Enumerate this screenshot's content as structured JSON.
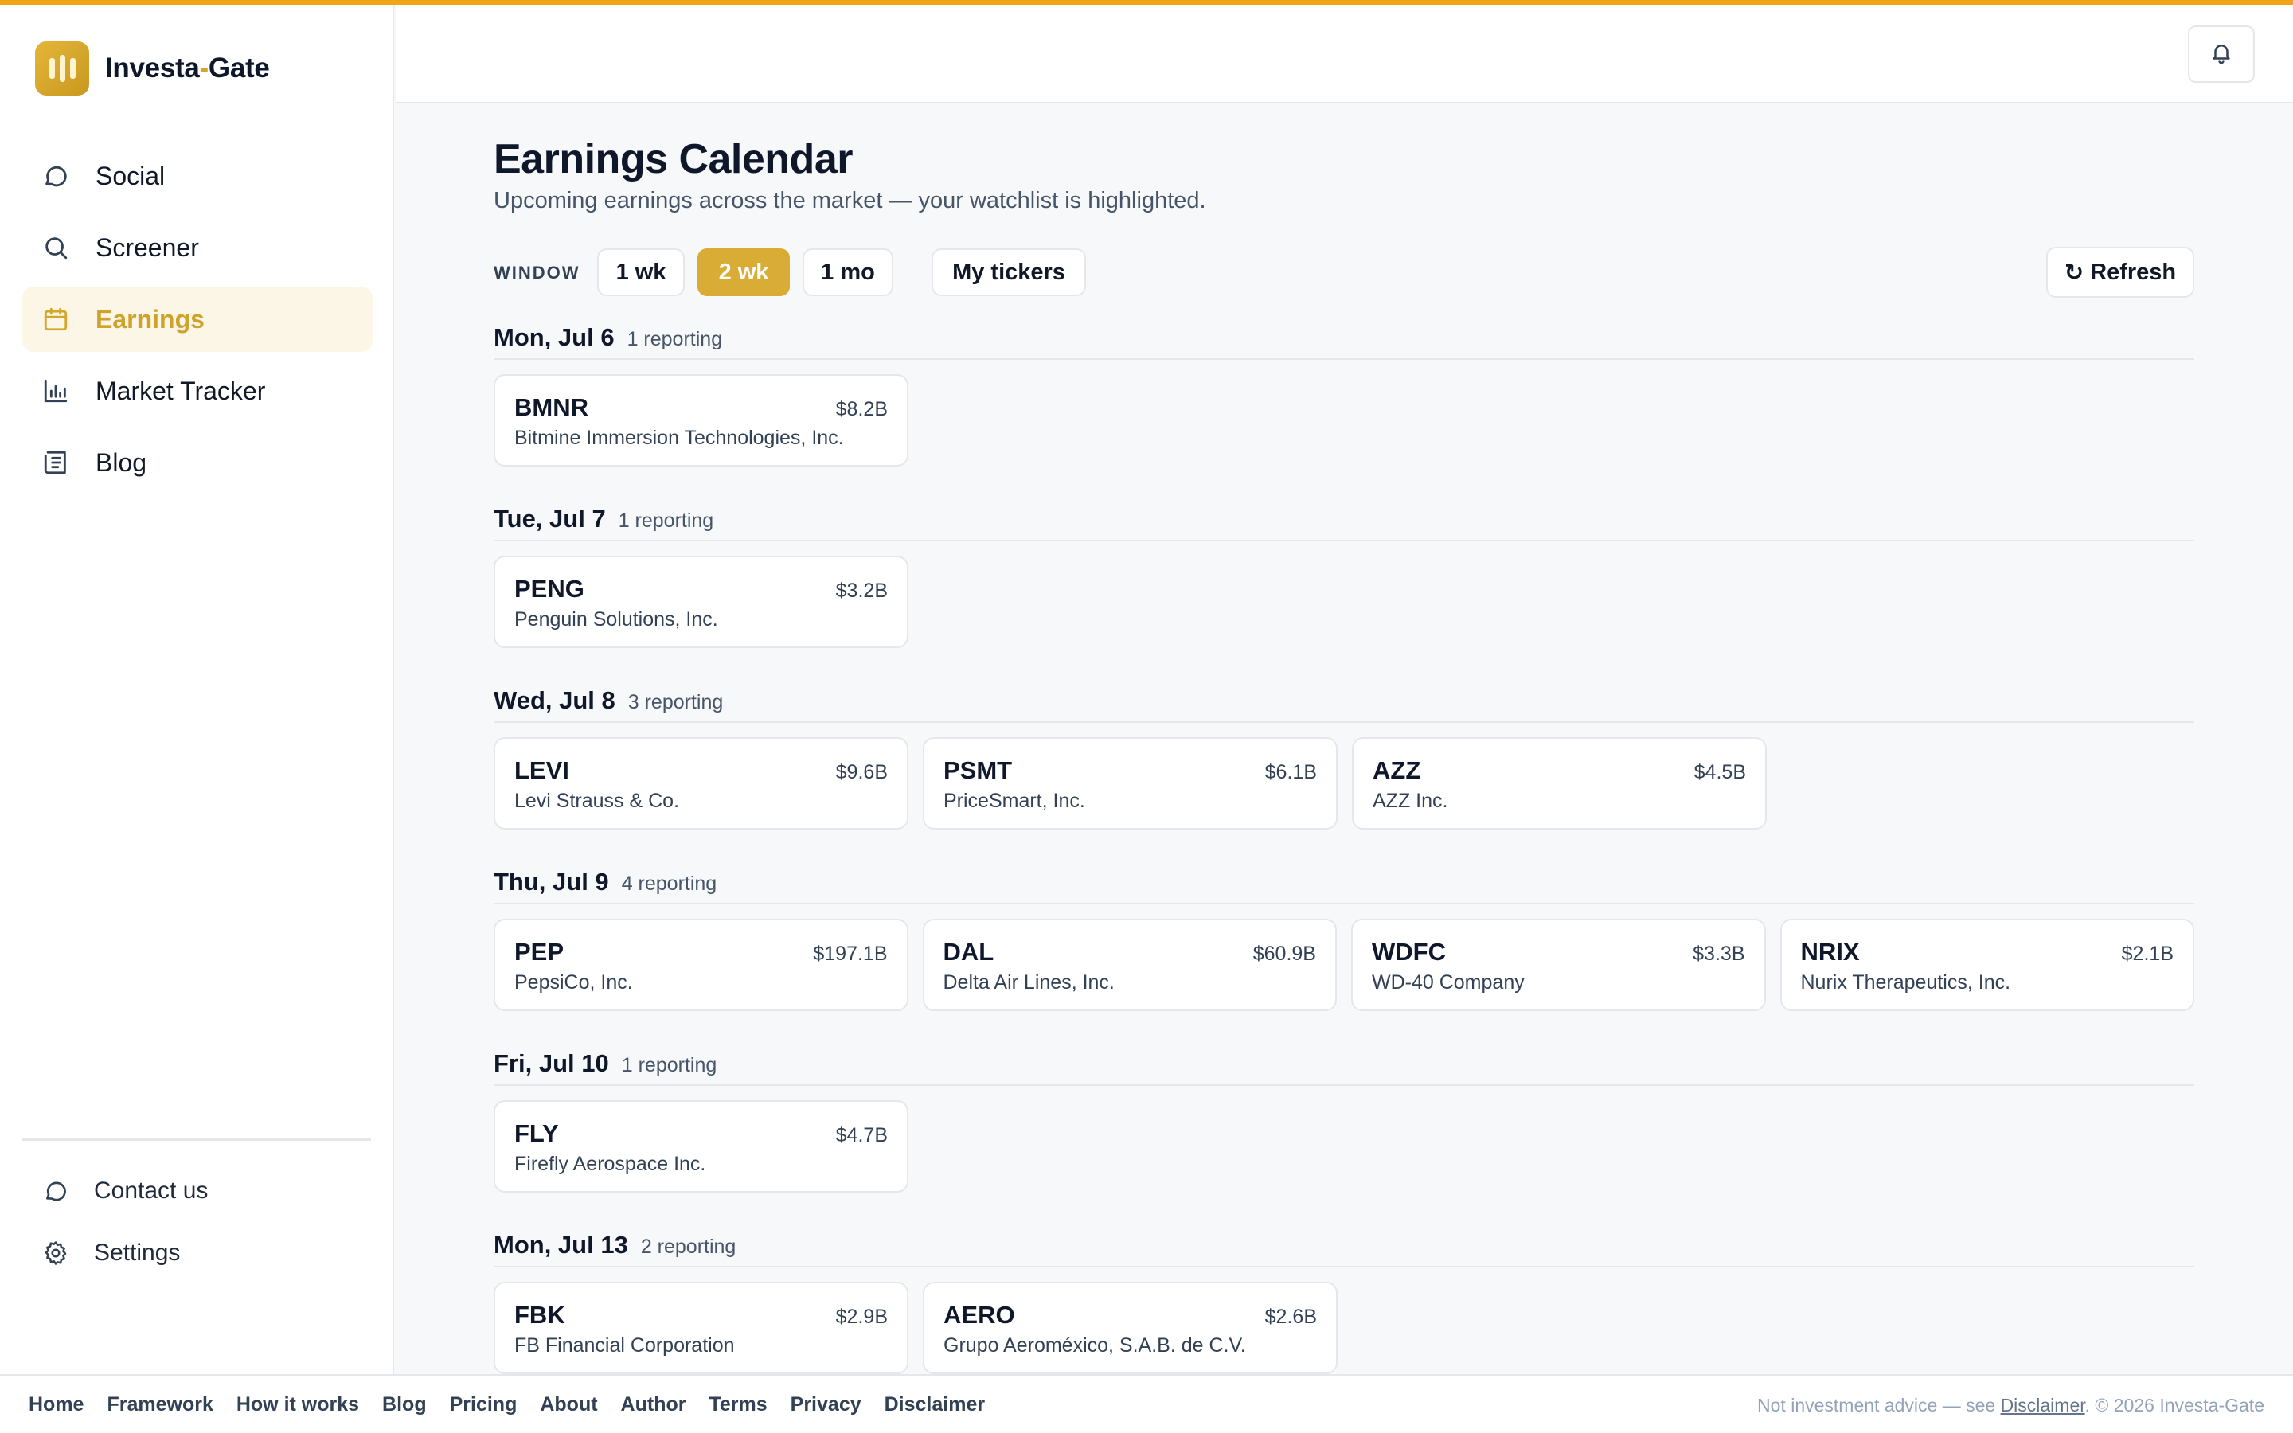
{
  "brand": {
    "name_part1": "Investa",
    "name_sep": "-",
    "name_part2": "Gate",
    "accent_color": "#d8ac35",
    "top_bar_color": "#f0a418"
  },
  "sidebar": {
    "items": [
      {
        "label": "Social",
        "icon": "chat-bubble-icon",
        "active": false
      },
      {
        "label": "Screener",
        "icon": "search-icon",
        "active": false
      },
      {
        "label": "Earnings",
        "icon": "calendar-icon",
        "active": true
      },
      {
        "label": "Market Tracker",
        "icon": "bar-chart-icon",
        "active": false
      },
      {
        "label": "Blog",
        "icon": "newspaper-icon",
        "active": false
      }
    ],
    "bottom_items": [
      {
        "label": "Contact us",
        "icon": "chat-bubble-icon"
      },
      {
        "label": "Settings",
        "icon": "gear-icon"
      }
    ]
  },
  "header": {
    "bell_icon": "bell-icon"
  },
  "page": {
    "title": "Earnings Calendar",
    "subtitle": "Upcoming earnings across the market — your watchlist is highlighted."
  },
  "controls": {
    "window_label": "WINDOW",
    "windows": [
      "1 wk",
      "2 wk",
      "1 mo"
    ],
    "selected_window": "2 wk",
    "my_tickers_label": "My tickers",
    "refresh_label": "Refresh",
    "refresh_icon_glyph": "↻"
  },
  "days": [
    {
      "date": "Mon, Jul 6",
      "count": "1 reporting",
      "companies": [
        {
          "ticker": "BMNR",
          "cap": "$8.2B",
          "name": "Bitmine Immersion Technologies, Inc."
        }
      ]
    },
    {
      "date": "Tue, Jul 7",
      "count": "1 reporting",
      "companies": [
        {
          "ticker": "PENG",
          "cap": "$3.2B",
          "name": "Penguin Solutions, Inc."
        }
      ]
    },
    {
      "date": "Wed, Jul 8",
      "count": "3 reporting",
      "companies": [
        {
          "ticker": "LEVI",
          "cap": "$9.6B",
          "name": "Levi Strauss & Co."
        },
        {
          "ticker": "PSMT",
          "cap": "$6.1B",
          "name": "PriceSmart, Inc."
        },
        {
          "ticker": "AZZ",
          "cap": "$4.5B",
          "name": "AZZ Inc."
        }
      ]
    },
    {
      "date": "Thu, Jul 9",
      "count": "4 reporting",
      "companies": [
        {
          "ticker": "PEP",
          "cap": "$197.1B",
          "name": "PepsiCo, Inc."
        },
        {
          "ticker": "DAL",
          "cap": "$60.9B",
          "name": "Delta Air Lines, Inc."
        },
        {
          "ticker": "WDFC",
          "cap": "$3.3B",
          "name": "WD-40 Company"
        },
        {
          "ticker": "NRIX",
          "cap": "$2.1B",
          "name": "Nurix Therapeutics, Inc."
        }
      ]
    },
    {
      "date": "Fri, Jul 10",
      "count": "1 reporting",
      "companies": [
        {
          "ticker": "FLY",
          "cap": "$4.7B",
          "name": "Firefly Aerospace Inc."
        }
      ]
    },
    {
      "date": "Mon, Jul 13",
      "count": "2 reporting",
      "companies": [
        {
          "ticker": "FBK",
          "cap": "$2.9B",
          "name": "FB Financial Corporation"
        },
        {
          "ticker": "AERO",
          "cap": "$2.6B",
          "name": "Grupo Aeroméxico, S.A.B. de C.V."
        }
      ]
    }
  ],
  "footer": {
    "links": [
      "Home",
      "Framework",
      "How it works",
      "Blog",
      "Pricing",
      "About",
      "Author",
      "Terms",
      "Privacy",
      "Disclaimer"
    ],
    "note_prefix": "Not investment advice — see ",
    "note_link": "Disclaimer",
    "note_suffix": ". © 2026 Investa-Gate"
  }
}
